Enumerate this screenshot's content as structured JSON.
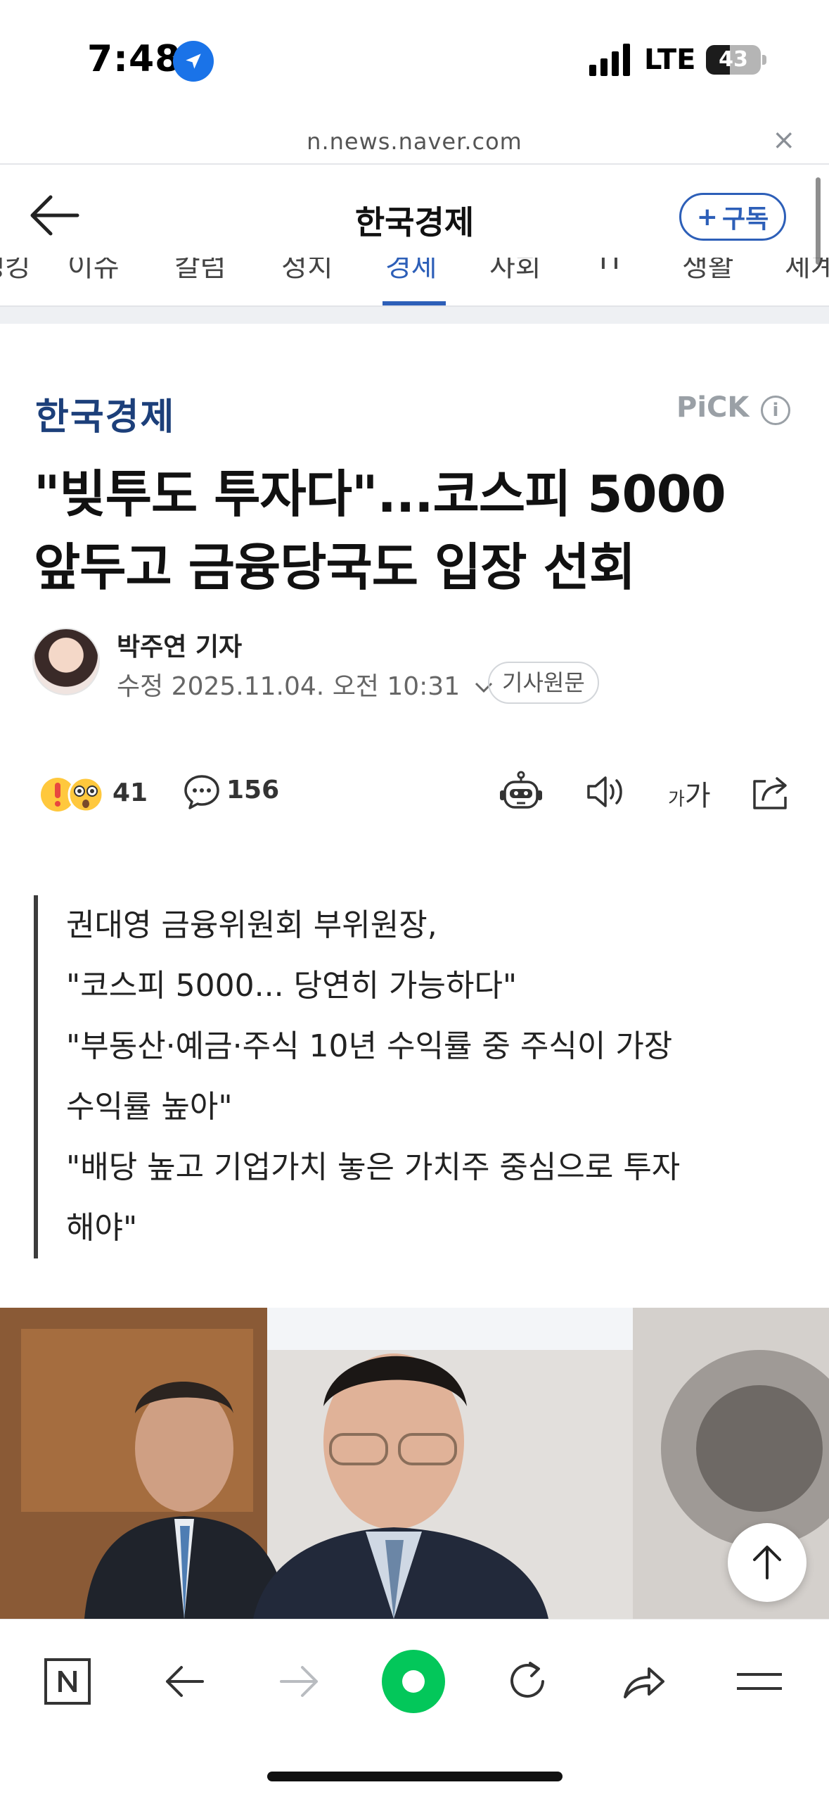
{
  "status_bar": {
    "time": "7:48",
    "network": "LTE",
    "battery_level": "43",
    "battery_fraction": 0.43
  },
  "browser": {
    "url": "n.news.naver.com",
    "close_symbol": "×"
  },
  "header": {
    "press_name": "한국경제",
    "subscribe_label": "구독",
    "subscribe_plus": "+"
  },
  "category_tabs": [
    {
      "label": "랭킹",
      "active": false
    },
    {
      "label": "이슈",
      "active": false
    },
    {
      "label": "칼럼",
      "active": false
    },
    {
      "label": "정치",
      "active": false
    },
    {
      "label": "경제",
      "active": true
    },
    {
      "label": "사회",
      "active": false
    },
    {
      "label": "IT",
      "active": false
    },
    {
      "label": "생활",
      "active": false
    },
    {
      "label": "세계",
      "active": false
    }
  ],
  "article": {
    "press_logo": "한국경제",
    "pick_label": "PiCK",
    "pick_info": "i",
    "headline_line1": "\"빚투도 투자다\"...코스피 5000",
    "headline_line2": "앞두고 금융당국도 입장 선회",
    "reporter": "박주연 기자",
    "date": "수정 2025.11.04. 오전 10:31",
    "original_label": "기사원문",
    "reaction_count": "41",
    "comment_count": "156",
    "font_small": "가",
    "font_big": "가",
    "summary": [
      "권대영 금융위원회 부위원장,",
      "\"코스피 5000... 당연히 가능하다\"",
      "\"부동산·예금·주식 10년 수익률 중 주식이 가장",
      "수익률 높아\"",
      "\"배당 높고 기업가치 놓은 가치주 중심으로 투자",
      "해야\""
    ]
  },
  "colors": {
    "accent": "#2d5fb8",
    "press_logo": "#1c3f7a",
    "naver_green": "#03c75a"
  },
  "icons": {
    "back": "left-arrow-icon",
    "location": "location-arrow-icon",
    "comment": "speech-bubble-icon",
    "robot": "robot-icon",
    "speaker": "speaker-icon",
    "share": "share-icon",
    "scroll_top": "up-arrow-icon",
    "naver": "naver-n-icon",
    "refresh": "refresh-icon",
    "menu": "menu-icon"
  }
}
